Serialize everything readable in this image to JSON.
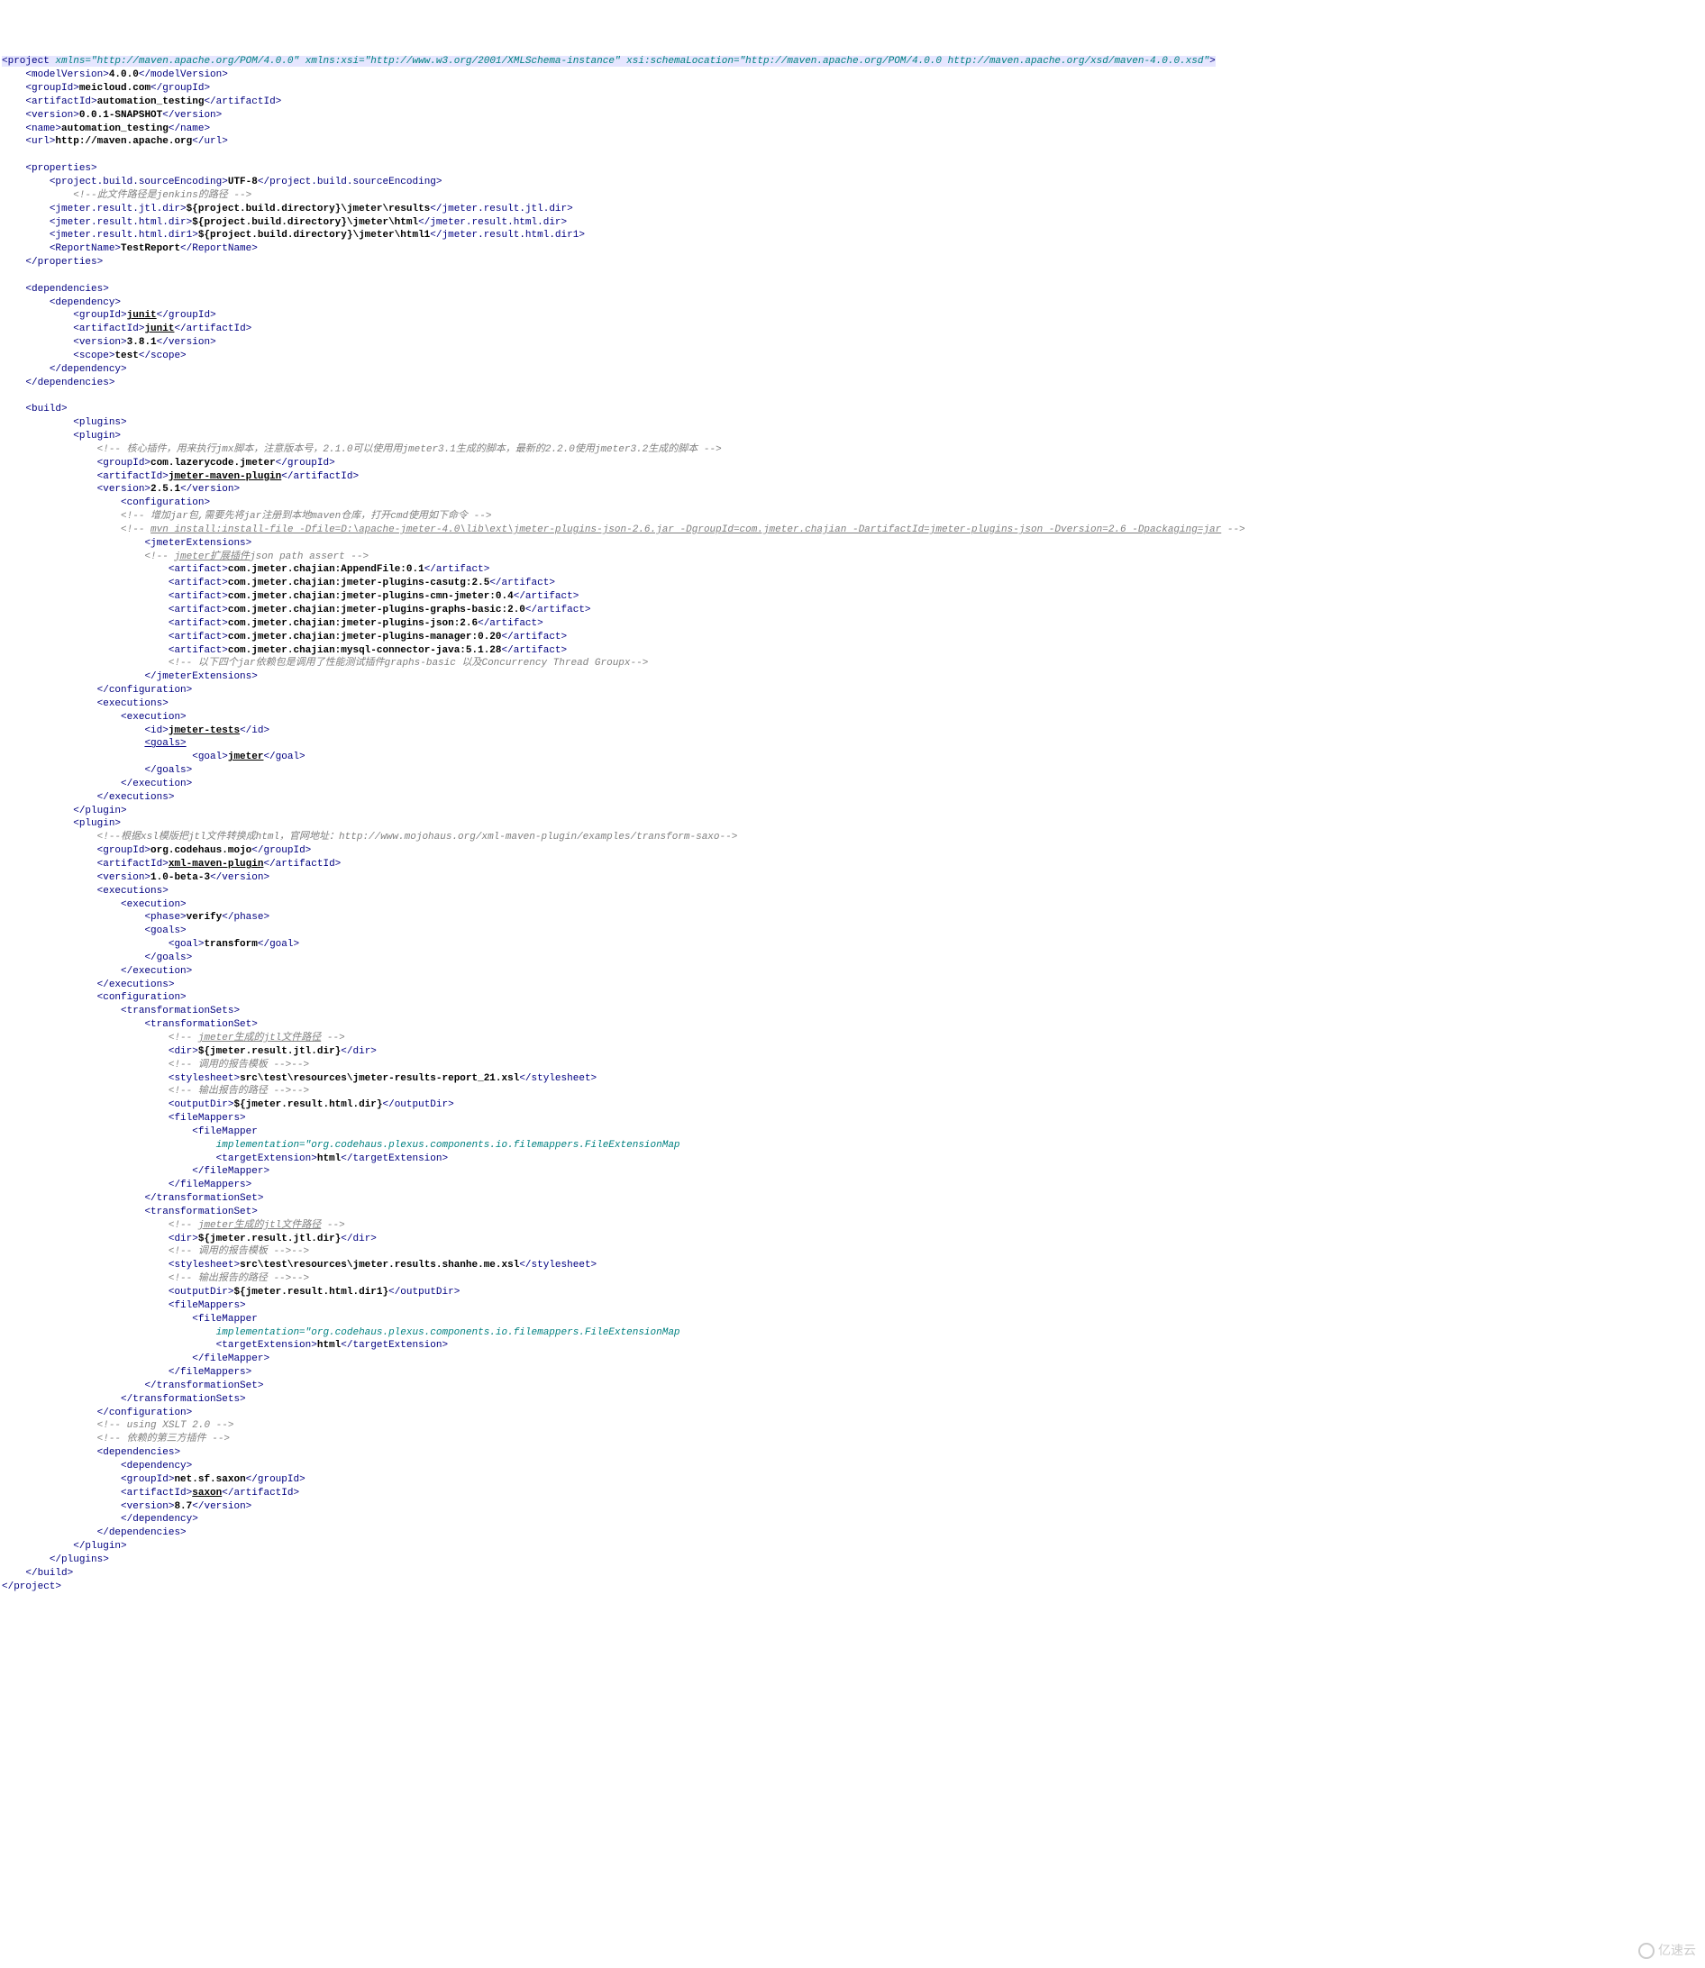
{
  "project": {
    "xmlns": "http://maven.apache.org/POM/4.0.0",
    "xmlns_xsi": "http://www.w3.org/2001/XMLSchema-instance",
    "xsi_schemaLocation": "http://maven.apache.org/POM/4.0.0 http://maven.apache.org/xsd/maven-4.0.0.xsd",
    "modelVersion": "4.0.0",
    "groupId": "meicloud.com",
    "artifactId": "automation_testing",
    "version": "0.0.1-SNAPSHOT",
    "name": "automation_testing",
    "url": "http://maven.apache.org"
  },
  "properties": {
    "encoding": "UTF-8",
    "jenkins_comment": "此文件路径是jenkins的路径",
    "jtl_dir": "${project.build.directory}\\jmeter\\results",
    "html_dir": "${project.build.directory}\\jmeter\\html",
    "html_dir1": "${project.build.directory}\\jmeter\\html1",
    "report_name": "TestReport"
  },
  "dependencies": [
    {
      "groupId": "junit",
      "artifactId": "junit",
      "version": "3.8.1",
      "scope": "test"
    }
  ],
  "plugins": {
    "jmeter": {
      "comment": "核心插件，用来执行jmx脚本，注意版本号，2.1.0可以使用用jmeter3.1生成的脚本，最新的2.2.0使用jmeter3.2生成的脚本",
      "groupId": "com.lazerycode.jmeter",
      "artifactId": "jmeter-maven-plugin",
      "version": "2.5.1",
      "config_comment1": "增加jar包,需要先将jar注册到本地maven仓库，打开cmd使用如下命令",
      "config_comment2": "mvn install:install-file -Dfile=D:\\apache-jmeter-4.0\\lib\\ext\\jmeter-plugins-json-2.6.jar -DgroupId=com.jmeter.chajian -DartifactId=jmeter-plugins-json -Dversion=2.6 -Dpackaging=jar",
      "ext_comment": "jmeter扩展插件json path assert",
      "artifacts": [
        "com.jmeter.chajian:AppendFile:0.1",
        "com.jmeter.chajian:jmeter-plugins-casutg:2.5",
        "com.jmeter.chajian:jmeter-plugins-cmn-jmeter:0.4",
        "com.jmeter.chajian:jmeter-plugins-graphs-basic:2.0",
        "com.jmeter.chajian:jmeter-plugins-json:2.6",
        "com.jmeter.chajian:jmeter-plugins-manager:0.20",
        "com.jmeter.chajian:mysql-connector-java:5.1.28"
      ],
      "artifacts_comment": "以下四个jar依赖包是调用了性能测试插件graphs-basic 以及Concurrency Thread Groupx",
      "execution": {
        "id": "jmeter-tests",
        "goal": "jmeter"
      }
    },
    "xml": {
      "comment": "根据xsl模版把jtl文件转换成html，官网地址：http://www.mojohaus.org/xml-maven-plugin/examples/transform-saxo",
      "groupId": "org.codehaus.mojo",
      "artifactId": "xml-maven-plugin",
      "version": "1.0-beta-3",
      "execution": {
        "phase": "verify",
        "goal": "transform"
      },
      "ts1": {
        "jtl_comment": "jmeter生成的jtl文件路径",
        "dir": "${jmeter.result.jtl.dir}",
        "tpl_comment": "调用的报告模板",
        "stylesheet": "src\\test\\resources\\jmeter-results-report_21.xsl",
        "out_comment": "输出报告的路径",
        "outputDir": "${jmeter.result.html.dir}",
        "fileMapper_impl": "org.codehaus.plexus.components.io.filemappers.FileExtensionMap",
        "targetExtension": "html"
      },
      "ts2": {
        "jtl_comment": "jmeter生成的jtl文件路径",
        "dir": "${jmeter.result.jtl.dir}",
        "tpl_comment": "调用的报告模板",
        "stylesheet": "src\\test\\resources\\jmeter.results.shanhe.me.xsl",
        "out_comment": "输出报告的路径",
        "outputDir": "${jmeter.result.html.dir1}",
        "fileMapper_impl": "org.codehaus.plexus.components.io.filemappers.FileExtensionMap",
        "targetExtension": "html"
      },
      "xslt_comment": "using XSLT 2.0",
      "dep_comment": "依赖的第三方插件",
      "dep": {
        "groupId": "net.sf.saxon",
        "artifactId": "saxon",
        "version": "8.7"
      }
    }
  },
  "logo": "亿速云"
}
